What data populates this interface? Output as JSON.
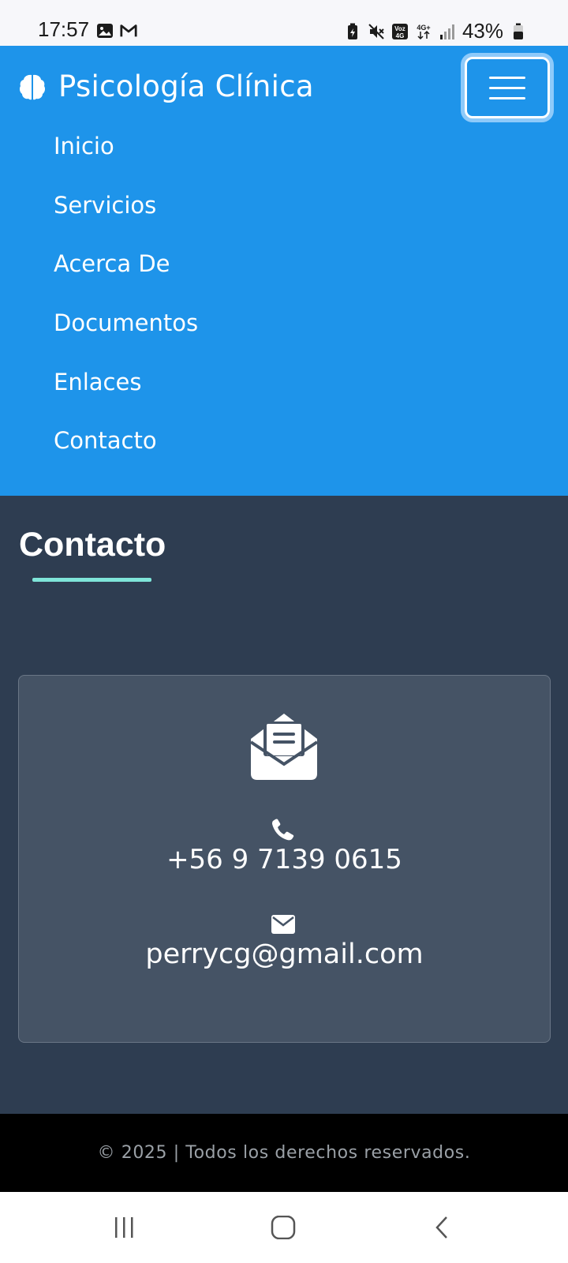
{
  "status_bar": {
    "time": "17:57",
    "battery": "43%",
    "left_icons": [
      "image-icon",
      "gmail-icon"
    ],
    "right_icons": [
      "battery-saver-icon",
      "mute-icon",
      "volte-icon",
      "4g-icon",
      "signal-icon",
      "battery-icon"
    ]
  },
  "navbar": {
    "brand_icon": "brain-icon",
    "brand": "Psicología Clínica",
    "menu_icon": "hamburger-icon",
    "links": [
      "Inicio",
      "Servicios",
      "Acerca De",
      "Documentos",
      "Enlaces",
      "Contacto"
    ]
  },
  "contact": {
    "title": "Contacto",
    "card_icon": "envelope-open-icon",
    "phone_icon": "phone-icon",
    "phone": "+56 9 7139 0615",
    "email_icon": "envelope-icon",
    "email": "perrycg@gmail.com"
  },
  "footer": {
    "text": "© 2025 | Todos los derechos reservados."
  },
  "android_nav": {
    "buttons": [
      "recents-icon",
      "home-icon",
      "back-icon"
    ]
  },
  "colors": {
    "navbar_bg": "#1e94ea",
    "section_bg": "#2e3d51",
    "card_bg": "#455365",
    "accent_underline": "#7fe5d9",
    "footer_bg": "#000000"
  }
}
